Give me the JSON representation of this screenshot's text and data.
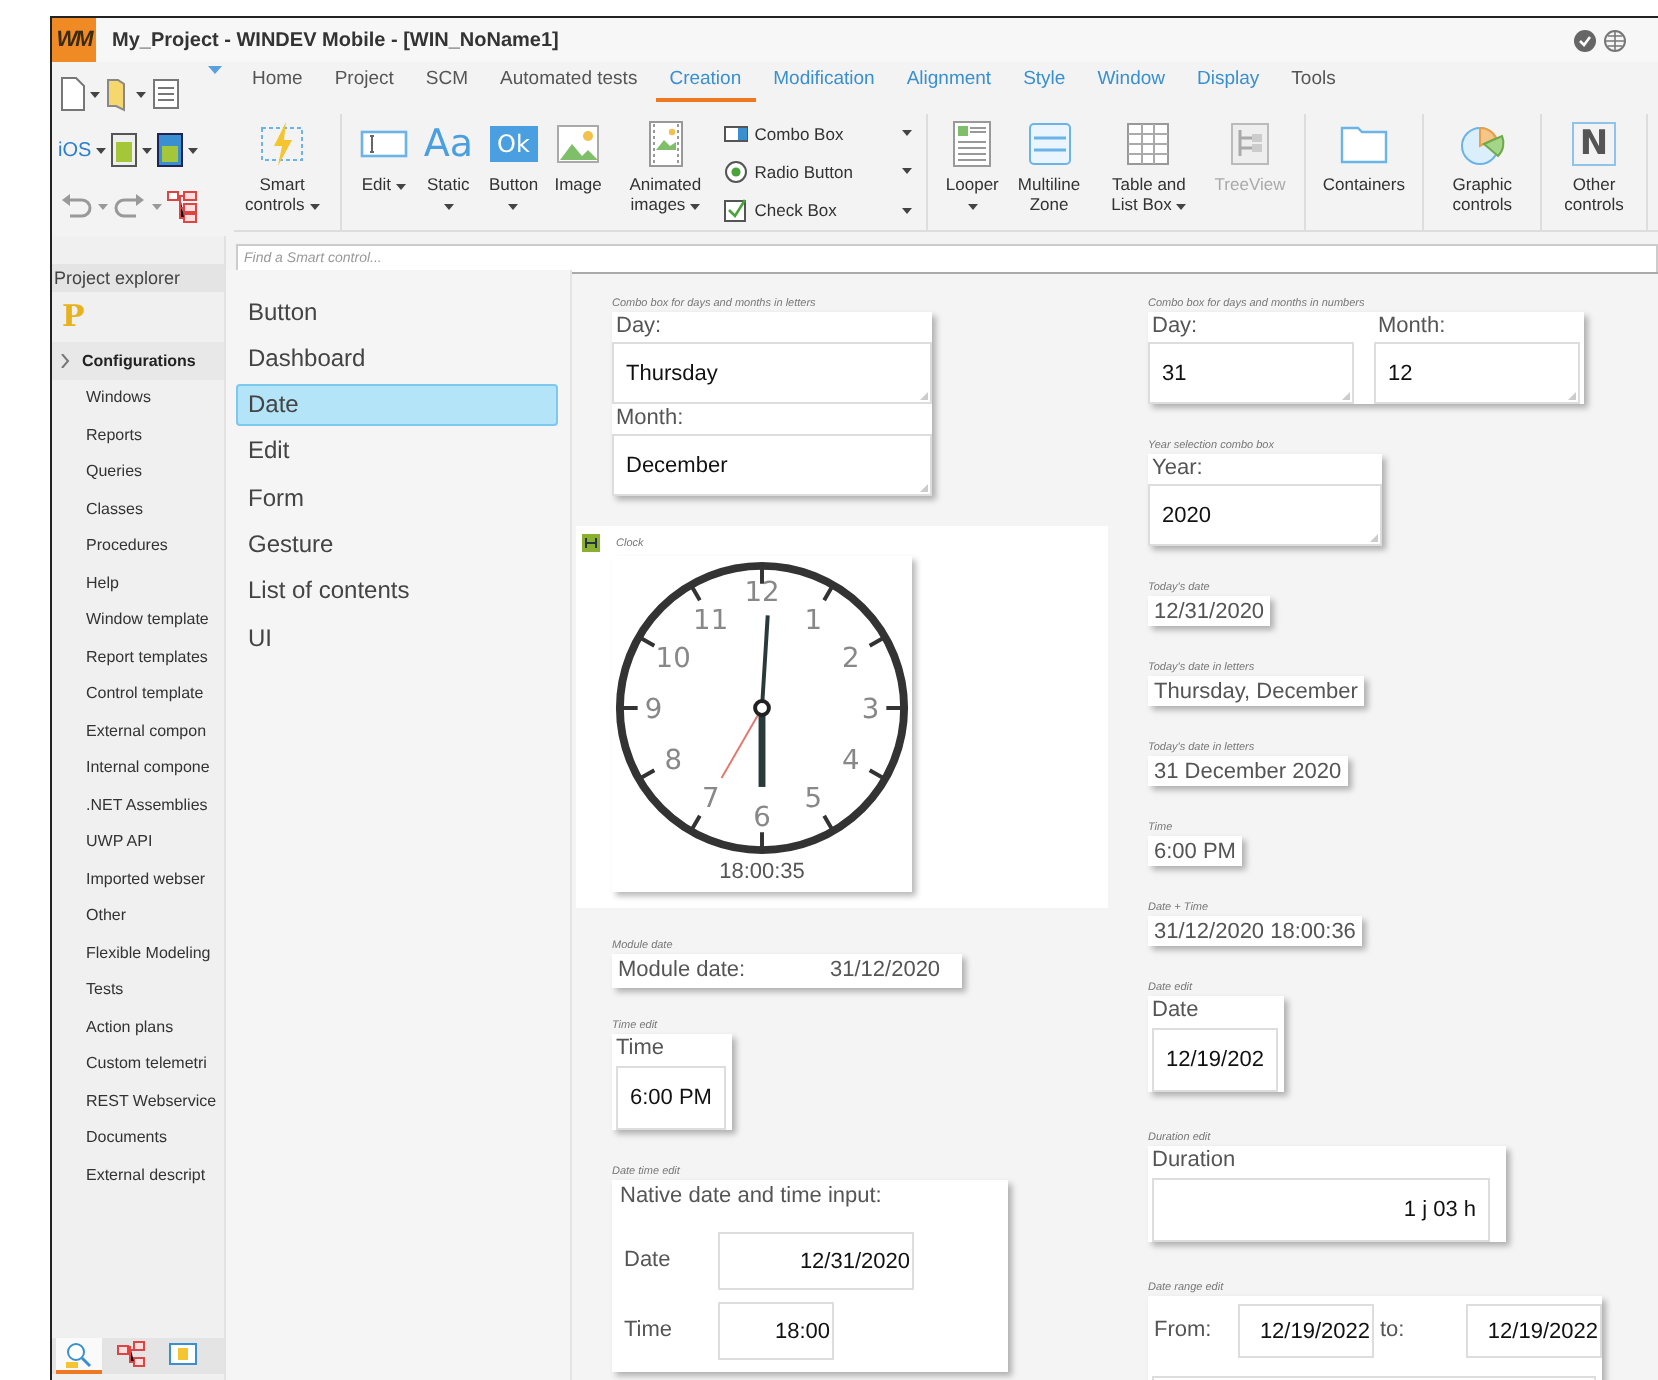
{
  "window": {
    "logo": "WM",
    "title": "My_Project - WINDEV Mobile - [WIN_NoName1]"
  },
  "quick_access": {
    "platform": "iOS"
  },
  "ribbon_tabs": [
    {
      "label": "Home",
      "contextual": false,
      "selected": false
    },
    {
      "label": "Project",
      "contextual": false,
      "selected": false
    },
    {
      "label": "SCM",
      "contextual": false,
      "selected": false
    },
    {
      "label": "Automated tests",
      "contextual": false,
      "selected": false
    },
    {
      "label": "Creation",
      "contextual": true,
      "selected": true
    },
    {
      "label": "Modification",
      "contextual": true,
      "selected": false
    },
    {
      "label": "Alignment",
      "contextual": true,
      "selected": false
    },
    {
      "label": "Style",
      "contextual": true,
      "selected": false
    },
    {
      "label": "Window",
      "contextual": true,
      "selected": false
    },
    {
      "label": "Display",
      "contextual": true,
      "selected": false
    },
    {
      "label": "Tools",
      "contextual": false,
      "selected": false
    }
  ],
  "ribbon_items": [
    {
      "kind": "large",
      "label": "Smart controls",
      "dropdown": true,
      "disabled": false,
      "group_end": true
    },
    {
      "kind": "large",
      "label": "Edit",
      "dropdown": true,
      "disabled": false,
      "group_end": false
    },
    {
      "kind": "large",
      "label": "Static",
      "glyph": "Aa",
      "dropdown": true,
      "disabled": false,
      "group_end": false
    },
    {
      "kind": "large",
      "label": "Button",
      "glyph": "Ok",
      "dropdown": true,
      "disabled": false,
      "group_end": false
    },
    {
      "kind": "large",
      "label": "Image",
      "dropdown": false,
      "disabled": false,
      "group_end": false
    },
    {
      "kind": "large",
      "label": "Animated images",
      "dropdown": true,
      "disabled": false,
      "group_end": false
    },
    {
      "kind": "stack",
      "group_end": true,
      "items": [
        {
          "label": "Combo Box"
        },
        {
          "label": "Radio Button"
        },
        {
          "label": "Check Box"
        }
      ]
    },
    {
      "kind": "large",
      "label": "Looper",
      "dropdown": true,
      "disabled": false,
      "group_end": false
    },
    {
      "kind": "large",
      "label": "Multiline Zone",
      "dropdown": false,
      "disabled": false,
      "group_end": false
    },
    {
      "kind": "large",
      "label": "Table and List Box",
      "dropdown": true,
      "disabled": false,
      "group_end": false
    },
    {
      "kind": "large",
      "label": "TreeView",
      "dropdown": false,
      "disabled": true,
      "group_end": true
    },
    {
      "kind": "large",
      "label": "Containers",
      "dropdown": false,
      "disabled": false,
      "group_end": true
    },
    {
      "kind": "large",
      "label": "Graphic controls",
      "dropdown": false,
      "disabled": false,
      "group_end": true
    },
    {
      "kind": "large",
      "label": "Other controls",
      "glyph": "N",
      "dropdown": false,
      "disabled": false,
      "group_end": true
    }
  ],
  "project_explorer": {
    "title": "Project explorer",
    "logo": "P",
    "items": [
      {
        "label": "Configurations",
        "kind": "group"
      },
      {
        "label": "Windows",
        "kind": "item"
      },
      {
        "label": "Reports",
        "kind": "item"
      },
      {
        "label": "Queries",
        "kind": "item"
      },
      {
        "label": "Classes",
        "kind": "item"
      },
      {
        "label": "Procedures",
        "kind": "item"
      },
      {
        "label": "Help",
        "kind": "item"
      },
      {
        "label": "Window template",
        "kind": "item"
      },
      {
        "label": "Report templates",
        "kind": "item"
      },
      {
        "label": "Control template",
        "kind": "item"
      },
      {
        "label": "External compon",
        "kind": "item"
      },
      {
        "label": "Internal compone",
        "kind": "item"
      },
      {
        "label": ".NET Assemblies",
        "kind": "item"
      },
      {
        "label": "UWP API",
        "kind": "item"
      },
      {
        "label": "Imported webser",
        "kind": "item"
      },
      {
        "label": "Other",
        "kind": "item"
      },
      {
        "label": "Flexible Modeling",
        "kind": "item"
      },
      {
        "label": "Tests",
        "kind": "item"
      },
      {
        "label": "Action plans",
        "kind": "item"
      },
      {
        "label": "Custom telemetri",
        "kind": "item"
      },
      {
        "label": "REST Webservice",
        "kind": "item"
      },
      {
        "label": "Documents",
        "kind": "item"
      },
      {
        "label": "External descript",
        "kind": "item"
      }
    ],
    "tabs": [
      {
        "selected": true
      },
      {
        "selected": false
      },
      {
        "selected": false
      }
    ]
  },
  "smart_controls": {
    "search": {
      "placeholder": "Find a Smart control..."
    },
    "items": [
      {
        "label": "Button",
        "selected": false
      },
      {
        "label": "Dashboard",
        "selected": false
      },
      {
        "label": "Date",
        "selected": true
      },
      {
        "label": "Edit",
        "selected": false
      },
      {
        "label": "Form",
        "selected": false
      },
      {
        "label": "Gesture",
        "selected": false
      },
      {
        "label": "List of contents",
        "selected": false
      },
      {
        "label": "UI",
        "selected": false
      }
    ]
  },
  "canvas": {
    "left": [
      {
        "kind": "combo_stack",
        "caption": "Combo box for days and months in letters",
        "fields": [
          {
            "label": "Day:",
            "value": "Thursday"
          },
          {
            "label": "Month:",
            "value": "December"
          }
        ]
      },
      {
        "kind": "clock",
        "caption": "Clock",
        "dial_numbers": [
          "12",
          "1",
          "2",
          "3",
          "4",
          "5",
          "6",
          "7",
          "8",
          "9",
          "10",
          "11"
        ],
        "time": "18:00:35"
      },
      {
        "kind": "label_value",
        "caption": "Module date",
        "label": "Module date:",
        "value": "31/12/2020"
      },
      {
        "kind": "edit",
        "caption": "Time edit",
        "label": "Time",
        "value": "6:00 PM"
      },
      {
        "kind": "native_datetime",
        "caption": "Date time edit",
        "title": "Native date and time input:",
        "rows": [
          {
            "label": "Date",
            "value": "12/31/2020"
          },
          {
            "label": "Time",
            "value": "18:00"
          }
        ]
      }
    ],
    "right": [
      {
        "kind": "combo_row",
        "caption": "Combo box for days and months in numbers",
        "fields": [
          {
            "label": "Day:",
            "value": "31"
          },
          {
            "label": "Month:",
            "value": "12"
          }
        ]
      },
      {
        "kind": "combo_stack",
        "caption": "Year selection combo box",
        "fields": [
          {
            "label": "Year:",
            "value": "2020"
          }
        ]
      },
      {
        "kind": "static",
        "caption": "Today's date",
        "value": "12/31/2020"
      },
      {
        "kind": "static",
        "caption": "Today's date in letters",
        "value": "Thursday, December"
      },
      {
        "kind": "static",
        "caption": "Today's date in letters",
        "value": "31 December 2020"
      },
      {
        "kind": "static",
        "caption": "Time",
        "value": "6:00 PM"
      },
      {
        "kind": "static",
        "caption": "Date + Time",
        "value": "31/12/2020 18:00:36"
      },
      {
        "kind": "edit",
        "caption": "Date edit",
        "label": "Date",
        "value": "12/19/202"
      },
      {
        "kind": "duration",
        "caption": "Duration edit",
        "label": "Duration",
        "value": "1 j 03 h"
      },
      {
        "kind": "range",
        "caption": "Date range edit",
        "from_label": "From:",
        "from": "12/19/2022",
        "to_label": "to:",
        "to": "12/19/2022"
      }
    ]
  }
}
